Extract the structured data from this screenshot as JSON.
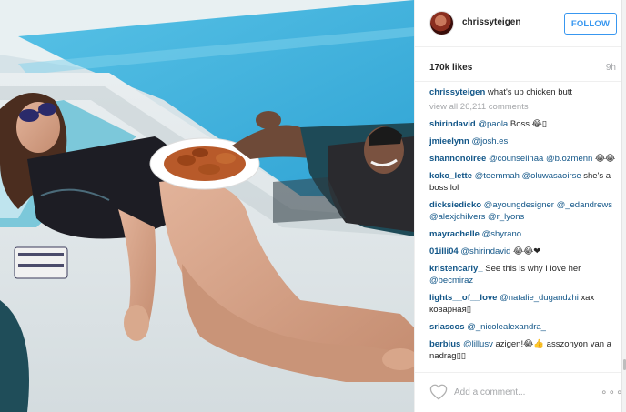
{
  "post": {
    "author": "chrissyteigen",
    "follow_label": "FOLLOW",
    "likes": "170k likes",
    "time": "9h",
    "caption": {
      "user": "chrissyteigen",
      "text": "what's up chicken butt"
    },
    "view_all_label": "view all 26,211 comments"
  },
  "comments": [
    {
      "user": "shirindavid",
      "parts": [
        {
          "t": "@paola",
          "m": true
        },
        {
          "t": " Boss 😂▯"
        }
      ]
    },
    {
      "user": "jmieelynn",
      "parts": [
        {
          "t": "@josh.es",
          "m": true
        }
      ]
    },
    {
      "user": "shannonolree",
      "parts": [
        {
          "t": "@counselinaa",
          "m": true
        },
        {
          "t": " "
        },
        {
          "t": "@b.ozmenn",
          "m": true
        },
        {
          "t": " 😂😂"
        }
      ]
    },
    {
      "user": "koko_lette",
      "parts": [
        {
          "t": "@teemmah",
          "m": true
        },
        {
          "t": " "
        },
        {
          "t": "@oluwasaoirse",
          "m": true
        },
        {
          "t": " she's a boss lol"
        }
      ]
    },
    {
      "user": "dicksiedicko",
      "parts": [
        {
          "t": "@ayoungdesigner",
          "m": true
        },
        {
          "t": " "
        },
        {
          "t": "@_edandrews",
          "m": true
        },
        {
          "t": " "
        },
        {
          "t": "@alexjchilvers",
          "m": true
        },
        {
          "t": " "
        },
        {
          "t": "@r_lyons",
          "m": true
        }
      ]
    },
    {
      "user": "mayrachelle",
      "parts": [
        {
          "t": "@shyrano",
          "m": true
        }
      ]
    },
    {
      "user": "01illi04",
      "parts": [
        {
          "t": "@shirindavid",
          "m": true
        },
        {
          "t": " 😂😂❤"
        }
      ]
    },
    {
      "user": "kristencarly_",
      "parts": [
        {
          "t": " See this is why I love her "
        },
        {
          "t": "@becmiraz",
          "m": true
        }
      ]
    },
    {
      "user": "lights__of__love",
      "parts": [
        {
          "t": "@natalie_dugandzhi",
          "m": true
        },
        {
          "t": " хах коварная▯"
        }
      ]
    },
    {
      "user": "sriascos",
      "parts": [
        {
          "t": "@_nicolealеxandra_",
          "m": true
        }
      ]
    },
    {
      "user": "berbius",
      "parts": [
        {
          "t": "@lillusv",
          "m": true
        },
        {
          "t": " azigen!😂👍 asszonyon van a nadrag▯▯"
        }
      ]
    }
  ],
  "add_comment_placeholder": "Add a comment...",
  "more_label": "∘∘∘",
  "icons": {
    "like": "heart-icon",
    "options": "more-options-icon"
  },
  "colors": {
    "link": "#125688",
    "accent": "#3897f0",
    "muted": "#a5a7aa"
  }
}
